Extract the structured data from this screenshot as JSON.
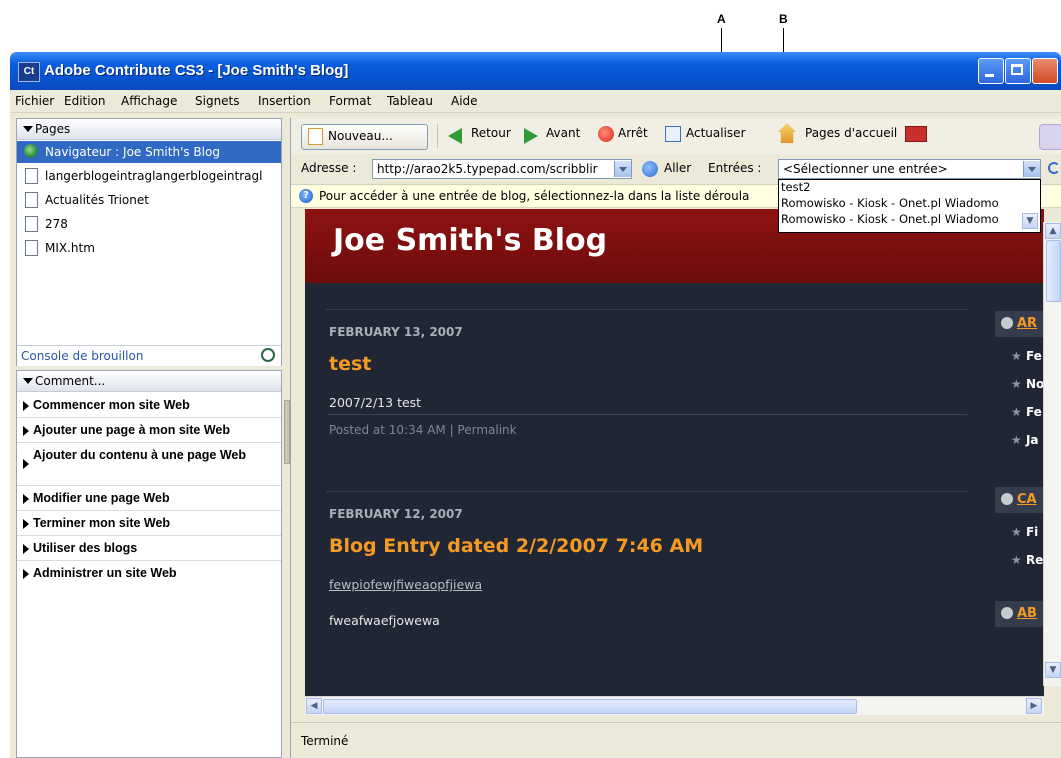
{
  "callouts": {
    "a": "A",
    "b": "B"
  },
  "window": {
    "title": "Adobe Contribute CS3 - [Joe Smith's Blog]",
    "app_icon_text": "Ct"
  },
  "menubar": {
    "items": [
      "Fichier",
      "Edition",
      "Affichage",
      "Signets",
      "Insertion",
      "Format",
      "Tableau",
      "Aide"
    ]
  },
  "pages_panel": {
    "header": "Pages",
    "items": [
      {
        "label": "Navigateur : Joe Smith's Blog",
        "icon": "globe-icon",
        "selected": true
      },
      {
        "label": "langerblogeintraglangerblogeintragl",
        "icon": "document-icon"
      },
      {
        "label": "Actualités Trionet",
        "icon": "document-icon"
      },
      {
        "label": "278",
        "icon": "document-icon"
      },
      {
        "label": "MIX.htm",
        "icon": "document-icon"
      }
    ],
    "console_link": "Console de brouillon"
  },
  "how_panel": {
    "header": "Comment...",
    "items": [
      "Commencer mon site Web",
      "Ajouter une page à mon site Web",
      "Ajouter du contenu à une page Web",
      "Modifier une page Web",
      "Terminer mon site Web",
      "Utiliser des blogs",
      "Administrer un site Web"
    ]
  },
  "toolbar": {
    "new_label": "Nouveau...",
    "back_label": "Retour",
    "forward_label": "Avant",
    "stop_label": "Arrêt",
    "refresh_label": "Actualiser",
    "home_label": "Pages d'accueil"
  },
  "addressbar": {
    "address_label": "Adresse :",
    "address_value": "http://arao2k5.typepad.com/scribblir",
    "go_label": "Aller",
    "entries_label": "Entrées :",
    "entries_selected": "<Sélectionner une entrée>",
    "entries_options": [
      "test2",
      "Romowisko - Kiosk - Onet.pl Wiadomo",
      "Romowisko - Kiosk - Onet.pl Wiadomo"
    ]
  },
  "infobar": {
    "text": "Pour accéder à une entrée de blog, sélectionnez-la dans la liste déroula"
  },
  "blog": {
    "title": "Joe Smith's Blog",
    "posts": [
      {
        "date": "FEBRUARY 13, 2007",
        "title": "test",
        "body": "2007/2/13 test",
        "meta": "Posted at 10:34 AM | Permalink"
      },
      {
        "date": "FEBRUARY 12, 2007",
        "title": "Blog Entry dated 2/2/2007 7:46 AM",
        "link": "fewpiofewjfiweaopfjiewa",
        "body": "fweafwaefjowewa"
      }
    ],
    "sidebar": {
      "heads": [
        "AR",
        "CA",
        "AB"
      ],
      "links_1": [
        "Fe",
        "No",
        "Fe",
        "Ja"
      ],
      "links_2": [
        "Fi",
        "Re"
      ]
    }
  },
  "statusbar": {
    "text": "Terminé"
  },
  "colors": {
    "title_blue": "#0653cf",
    "selection": "#316ac5",
    "blog_bg": "#202634",
    "blog_header": "#8e1212",
    "accent_orange": "#f59a23"
  }
}
